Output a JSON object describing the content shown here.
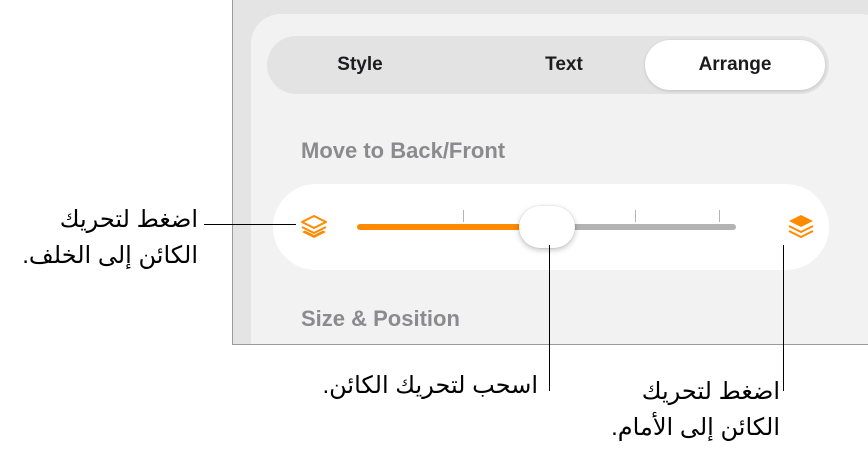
{
  "tabs": [
    {
      "label": "Style"
    },
    {
      "label": "Text"
    },
    {
      "label": "Arrange",
      "selected": true
    }
  ],
  "sections": {
    "move_title": "Move to Back/Front",
    "size_title": "Size & Position"
  },
  "slider": {
    "value_fraction": 0.48,
    "accent_color": "#ff8a00",
    "track_color": "#b3b3b3",
    "back_icon": "layers-back-icon",
    "front_icon": "layers-front-icon"
  },
  "callouts": {
    "back_line1": "اضغط لتحريك",
    "back_line2": "الكائن إلى الخلف.",
    "drag": "اسحب لتحريك الكائن.",
    "front_line1": "اضغط لتحريك",
    "front_line2": "الكائن إلى الأمام."
  }
}
